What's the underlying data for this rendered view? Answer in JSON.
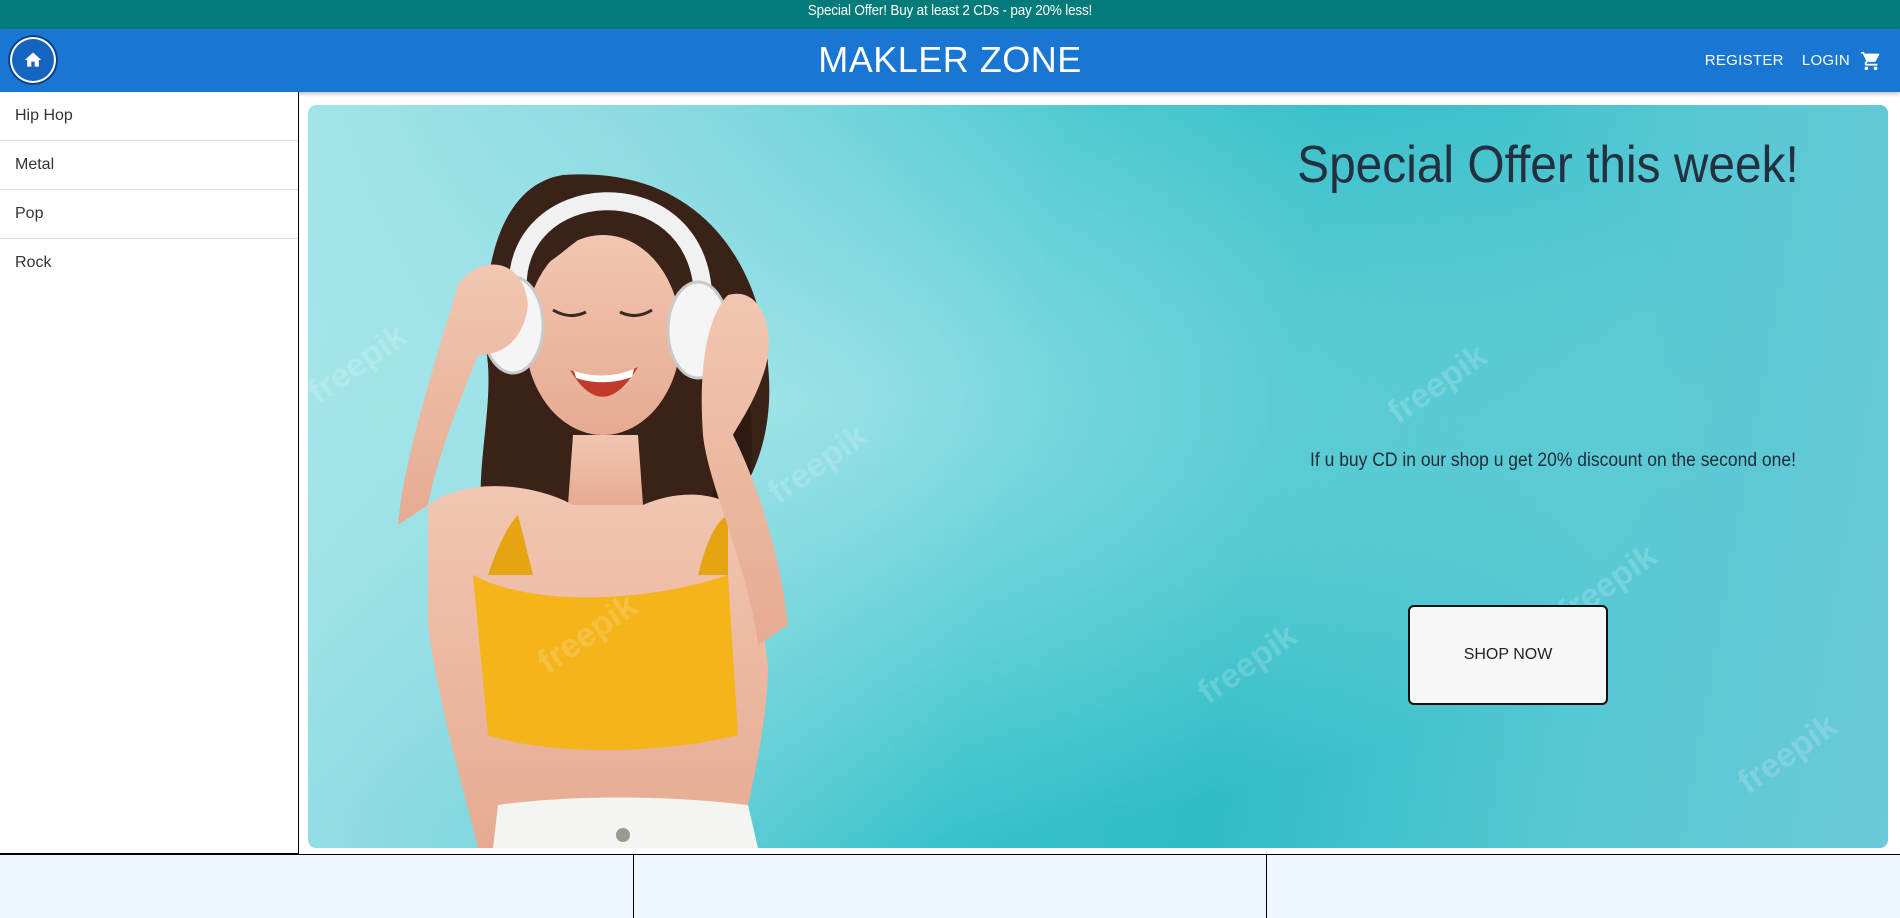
{
  "promo": {
    "text": "Special Offer! Buy at least 2 CDs - pay 20% less!"
  },
  "header": {
    "brand": "MAKLER ZONE",
    "register_label": "REGISTER",
    "login_label": "LOGIN",
    "home_icon": "home-icon",
    "cart_icon": "cart-icon"
  },
  "sidebar": {
    "items": [
      {
        "label": "Hip Hop"
      },
      {
        "label": "Metal"
      },
      {
        "label": "Pop"
      },
      {
        "label": "Rock"
      }
    ]
  },
  "hero": {
    "title": "Special Offer this week!",
    "text": "If u buy CD in our shop u get 20% discount on the second one!",
    "button_label": "SHOP NOW",
    "image_description_icon": "woman-with-headphones-image",
    "watermark": "freepik"
  },
  "colors": {
    "promo_bg": "#047b7b",
    "header_bg": "#1976d2",
    "hero_bg": "#38c2cb",
    "bottom_bg": "#eef6ff"
  }
}
